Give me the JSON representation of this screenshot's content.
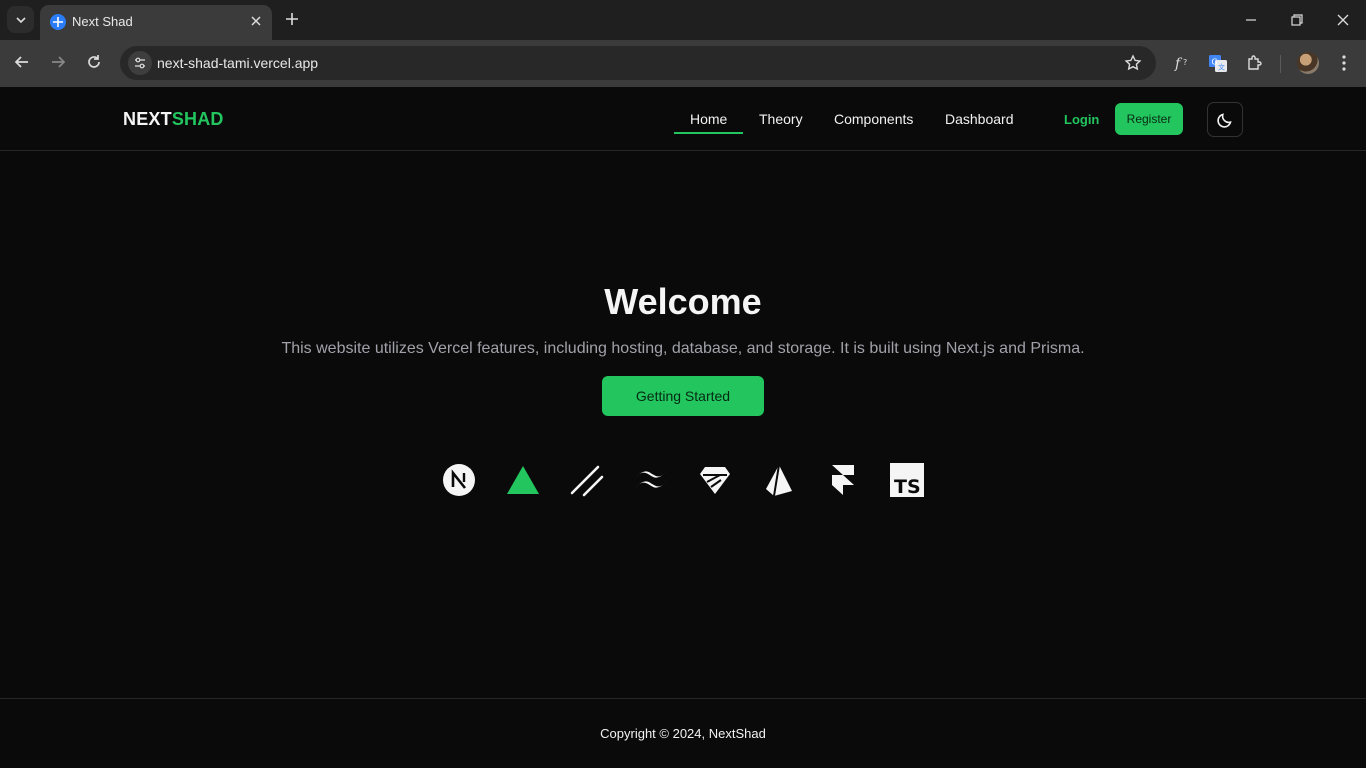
{
  "browser": {
    "tab_title": "Next Shad",
    "url": "next-shad-tami.vercel.app"
  },
  "site": {
    "logo_part1": "NEXT",
    "logo_part2": "SHAD",
    "nav": [
      "Home",
      "Theory",
      "Components",
      "Dashboard"
    ],
    "active_nav": "Home",
    "login_label": "Login",
    "register_label": "Register",
    "accent_color": "#22c55e"
  },
  "hero": {
    "title": "Welcome",
    "subtitle": "This website utilizes Vercel features, including hosting, database, and storage. It is built using Next.js and Prisma.",
    "cta_label": "Getting Started"
  },
  "tech_icons": [
    "nextjs-icon",
    "vercel-icon",
    "shadcn-icon",
    "tailwind-icon",
    "supabase-icon",
    "prisma-icon",
    "framer-icon",
    "typescript-icon"
  ],
  "footer": {
    "copyright": "Copyright © 2024, NextShad"
  }
}
